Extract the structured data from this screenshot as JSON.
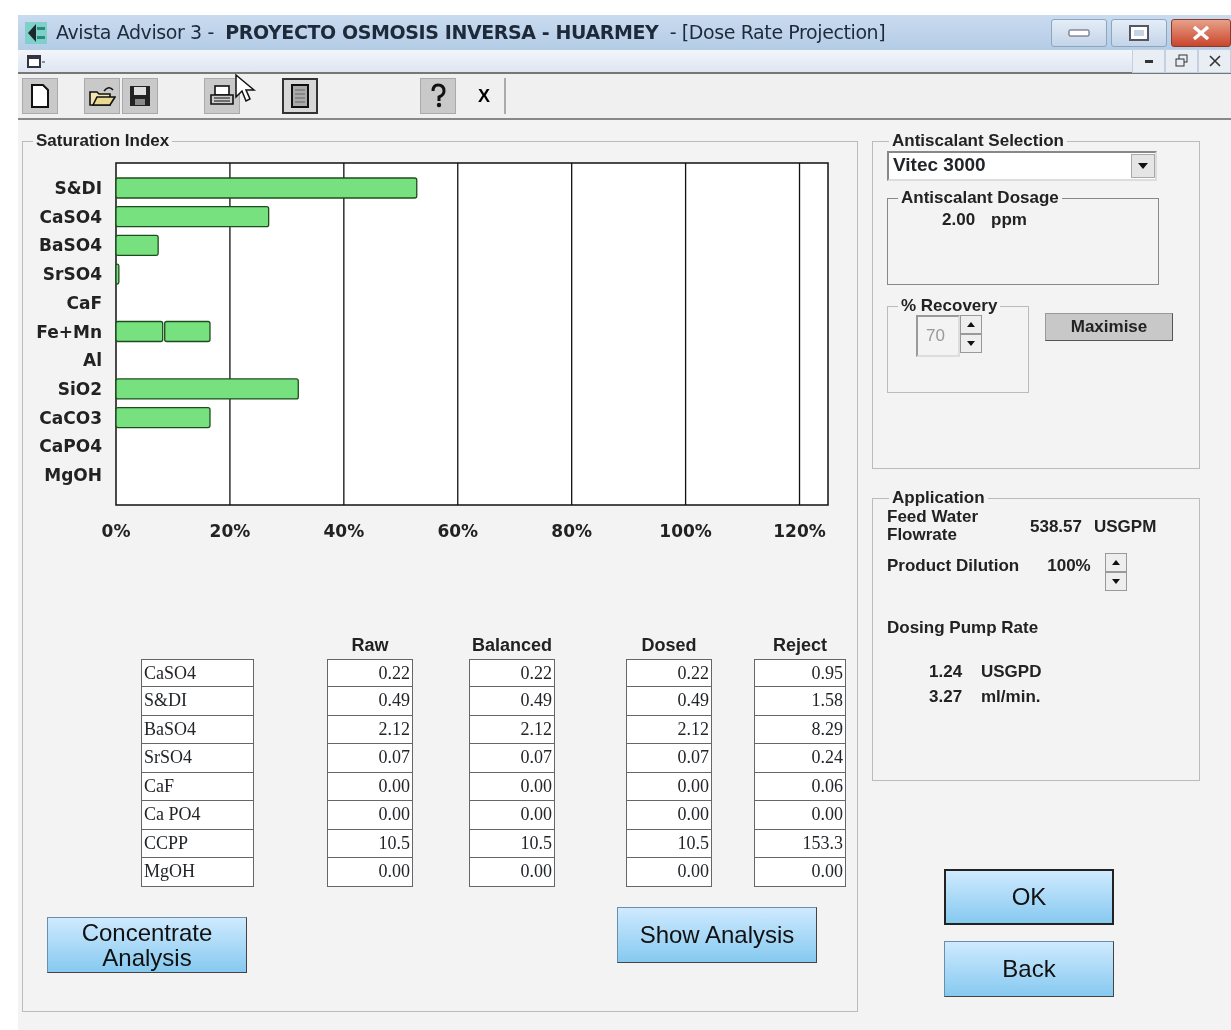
{
  "window": {
    "title": "Avista Advisor 3 -  **PROYECTO OSMOSIS INVERSA - HUARMEY**  - [Dose Rate Projection]"
  },
  "toolbar": [
    {
      "kind": "new",
      "pressed": false
    },
    {
      "kind": "open",
      "pressed": false
    },
    {
      "kind": "save",
      "pressed": false
    },
    {
      "kind": "print",
      "pressed": false
    },
    {
      "kind": "page",
      "pressed": true
    },
    {
      "kind": "help",
      "pressed": false
    },
    {
      "kind": "text",
      "label": "X",
      "pressed": false
    }
  ],
  "saturation": {
    "title": "Saturation Index",
    "chart_data": {
      "type": "bar",
      "orientation": "horizontal",
      "stacked": true,
      "categories": [
        "S&DI",
        "CaSO4",
        "BaSO4",
        "SrSO4",
        "CaF",
        "Fe+Mn",
        "Al",
        "SiO2",
        "CaCO3",
        "CaPO4",
        "MgOH"
      ],
      "series": [
        {
          "color": "#77e07f",
          "values": [
            52.8,
            26.8,
            7.4,
            0.5,
            null,
            8.2,
            null,
            32,
            16.5,
            null,
            null
          ]
        },
        {
          "color": "#77e07f",
          "values": [
            null,
            null,
            null,
            null,
            null,
            8.3,
            null,
            null,
            null,
            null,
            null
          ]
        }
      ],
      "xlim": [
        0,
        125
      ],
      "grid": true,
      "xticks": [
        {
          "value": 0,
          "label": "0%"
        },
        {
          "value": 20,
          "label": "20%"
        },
        {
          "value": 40,
          "label": "40%"
        },
        {
          "value": 60,
          "label": "60%"
        },
        {
          "value": 80,
          "label": "80%"
        },
        {
          "value": 100,
          "label": "100%"
        },
        {
          "value": 120,
          "label": "120%"
        }
      ]
    }
  },
  "table": {
    "columns": [
      "Raw",
      "Balanced",
      "Dosed",
      "Reject"
    ],
    "rows": [
      {
        "label": "CaSO4",
        "values": [
          "0.22",
          "0.22",
          "0.22",
          "0.95"
        ]
      },
      {
        "label": "S&DI",
        "values": [
          "0.49",
          "0.49",
          "0.49",
          "1.58"
        ]
      },
      {
        "label": "BaSO4",
        "values": [
          "2.12",
          "2.12",
          "2.12",
          "8.29"
        ]
      },
      {
        "label": "SrSO4",
        "values": [
          "0.07",
          "0.07",
          "0.07",
          "0.24"
        ]
      },
      {
        "label": "CaF",
        "values": [
          "0.00",
          "0.00",
          "0.00",
          "0.06"
        ]
      },
      {
        "label": "Ca PO4",
        "values": [
          "0.00",
          "0.00",
          "0.00",
          "0.00"
        ]
      },
      {
        "label": "CCPP",
        "values": [
          "10.5",
          "10.5",
          "10.5",
          "153.3"
        ]
      },
      {
        "label": "MgOH",
        "values": [
          "0.00",
          "0.00",
          "0.00",
          "0.00"
        ]
      }
    ]
  },
  "bottom_buttons": [
    "Concentrate Analysis",
    "Show Analysis"
  ],
  "antiscalant": {
    "title": "Antiscalant Selection",
    "product": "Vitec 3000",
    "dosage_title": "Antiscalant Dosage",
    "dosage_value": "2.00",
    "dosage_unit": "ppm",
    "recovery_title": "% Recovery",
    "recovery_value": "70",
    "recovery_disabled": true,
    "maximise": "Maximise"
  },
  "application": {
    "title": "Application",
    "feed_label": "Feed Water Flowrate",
    "feed_value": "538.57",
    "feed_unit": "USGPM",
    "dilution_label": "Product Dilution",
    "dilution_value": "100%",
    "pump_label": "Dosing Pump Rate",
    "pump_rates": [
      {
        "value": "1.24",
        "unit": "USGPD"
      },
      {
        "value": "3.27",
        "unit": "ml/min."
      }
    ]
  },
  "dialog_buttons": [
    {
      "label": "OK",
      "default": true
    },
    {
      "label": "Back",
      "default": false
    }
  ]
}
